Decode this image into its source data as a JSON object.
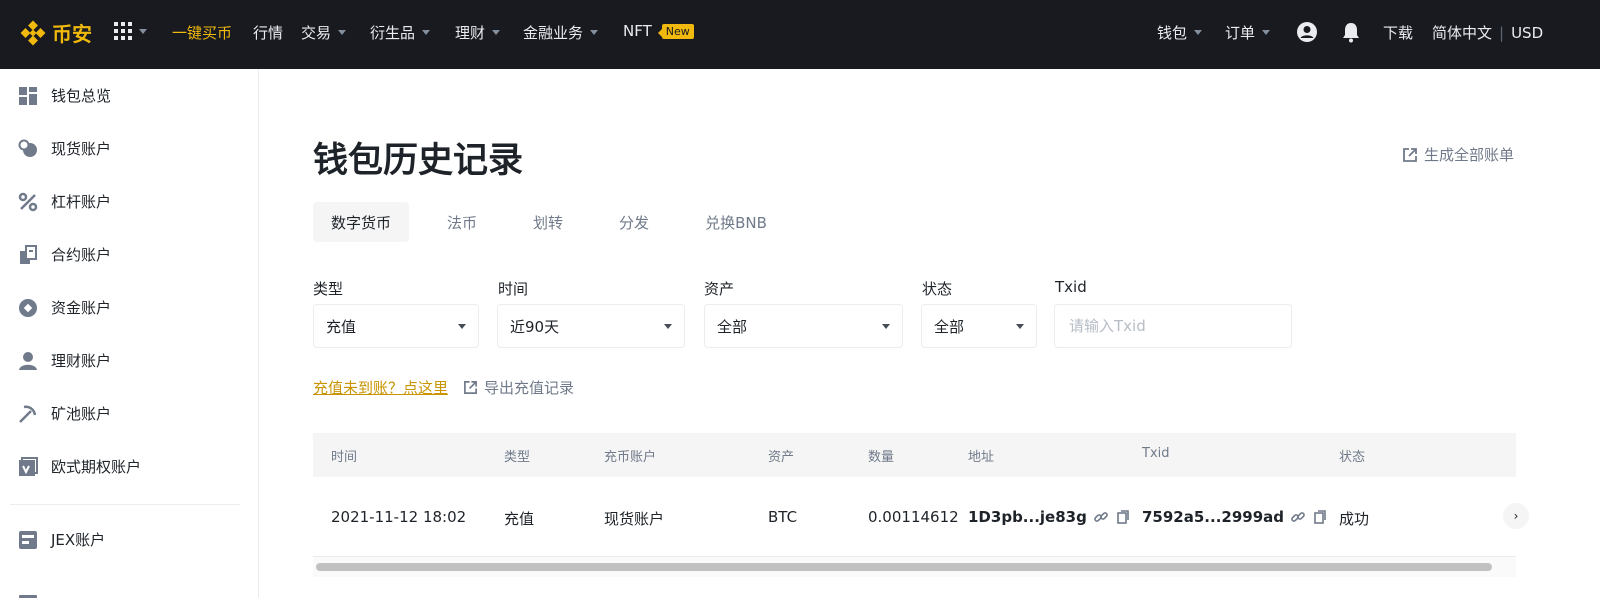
{
  "brand": {
    "name": "币安",
    "accent": "#f0b90b"
  },
  "nav": {
    "left": [
      {
        "label": "一键买币",
        "caret": false,
        "active": true
      },
      {
        "label": "行情",
        "caret": false
      },
      {
        "label": "交易",
        "caret": true
      },
      {
        "label": "衍生品",
        "caret": true
      },
      {
        "label": "理财",
        "caret": true
      },
      {
        "label": "金融业务",
        "caret": true
      },
      {
        "label": "NFT",
        "caret": false,
        "badge": "New"
      }
    ],
    "right": {
      "wallet": "钱包",
      "orders": "订单",
      "download": "下载",
      "language": "简体中文",
      "divider": "|",
      "currency": "USD"
    }
  },
  "sidebar": {
    "items": [
      {
        "label": "钱包总览",
        "icon": "dashboard-icon"
      },
      {
        "label": "现货账户",
        "icon": "spot-icon"
      },
      {
        "label": "杠杆账户",
        "icon": "margin-icon"
      },
      {
        "label": "合约账户",
        "icon": "futures-icon"
      },
      {
        "label": "资金账户",
        "icon": "funding-icon"
      },
      {
        "label": "理财账户",
        "icon": "earn-icon"
      },
      {
        "label": "矿池账户",
        "icon": "pool-icon"
      },
      {
        "label": "欧式期权账户",
        "icon": "options-icon"
      },
      {
        "label": "JEX账户",
        "icon": "jex-icon"
      }
    ]
  },
  "page": {
    "title": "钱包历史记录",
    "generate_statement": "生成全部账单"
  },
  "tabs": [
    "数字货币",
    "法币",
    "划转",
    "分发",
    "兑换BNB"
  ],
  "filters": {
    "type": {
      "label": "类型",
      "value": "充值"
    },
    "time": {
      "label": "时间",
      "value": "近90天"
    },
    "asset": {
      "label": "资产",
      "value": "全部"
    },
    "status": {
      "label": "状态",
      "value": "全部"
    },
    "txid": {
      "label": "Txid",
      "placeholder": "请输入Txid"
    }
  },
  "links": {
    "deposit_missing": "充值未到账？点这里",
    "export": "导出充值记录"
  },
  "table": {
    "columns": [
      "时间",
      "类型",
      "充币账户",
      "资产",
      "数量",
      "地址",
      "Txid",
      "状态"
    ],
    "rows": [
      {
        "time": "2021-11-12 18:02",
        "type": "充值",
        "account": "现货账户",
        "asset": "BTC",
        "amount": "0.00114612",
        "address": "1D3pb...je83g",
        "txid": "7592a5...2999ad",
        "status": "成功"
      }
    ]
  }
}
